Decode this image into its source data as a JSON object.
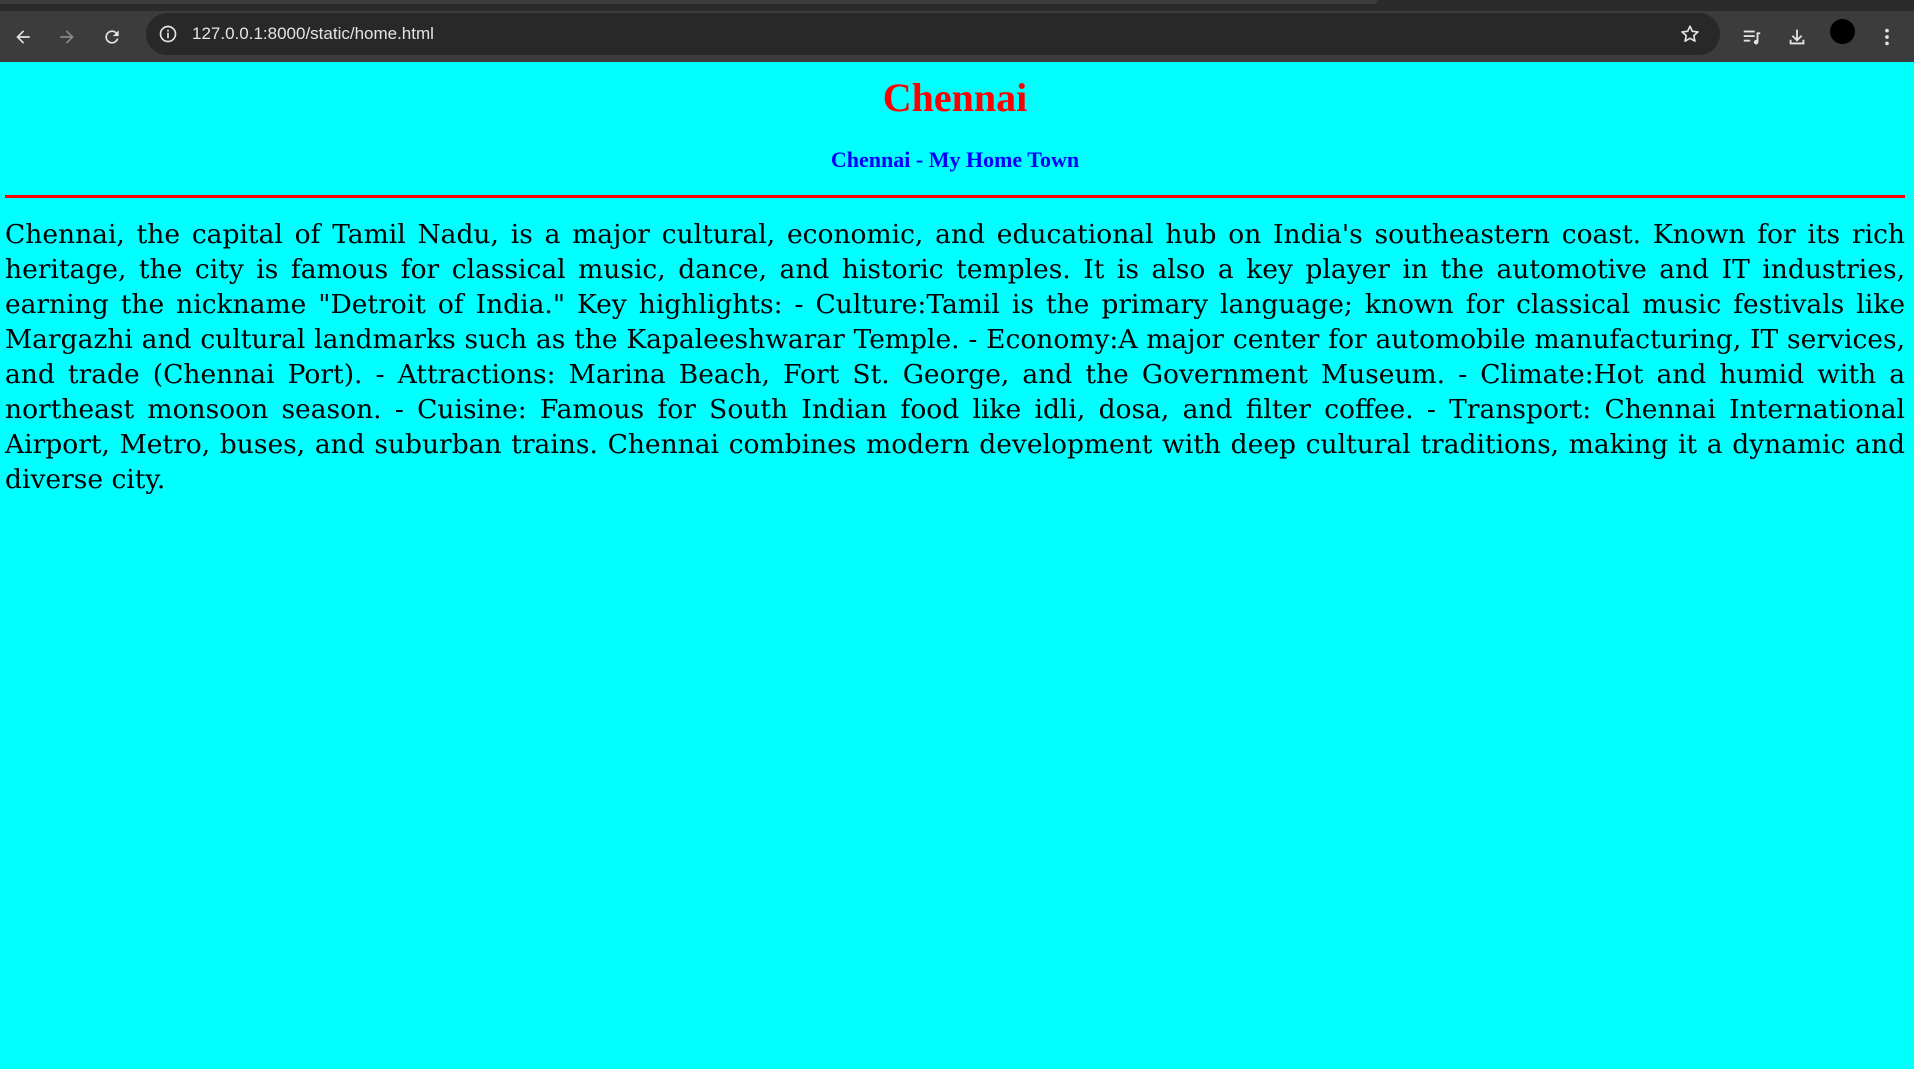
{
  "browser": {
    "url": "127.0.0.1:8000/static/home.html",
    "icons": {
      "back": "back-arrow-icon",
      "forward": "forward-arrow-icon",
      "reload": "reload-icon",
      "site_info": "info-icon",
      "bookmark": "star-icon",
      "media": "media-controls-icon",
      "downloads": "download-icon",
      "profile": "profile-avatar",
      "menu": "kebab-menu-icon"
    }
  },
  "page": {
    "background": "#00ffff",
    "title": "Chennai",
    "title_color": "#ff0000",
    "subtitle": "Chennai - My Home Town",
    "subtitle_color": "#0000ff",
    "divider_color": "#ff0000",
    "body": "Chennai, the capital of Tamil Nadu, is a major cultural, economic, and educational hub on India's southeastern coast. Known for its rich heritage, the city is famous for classical music, dance, and historic temples. It is also a key player in the automotive and IT industries, earning the nickname \"Detroit of India.\" Key highlights: - Culture:Tamil is the primary language; known for classical music festivals like Margazhi and cultural landmarks such as the Kapaleeshwarar Temple. - Economy:A major center for automobile manufacturing, IT services, and trade (Chennai Port). - Attractions: Marina Beach, Fort St. George, and the Government Museum. - Climate:Hot and humid with a northeast monsoon season. - Cuisine: Famous for South Indian food like idli, dosa, and filter coffee. - Transport: Chennai International Airport, Metro, buses, and suburban trains. Chennai combines modern development with deep cultural traditions, making it a dynamic and diverse city."
  }
}
